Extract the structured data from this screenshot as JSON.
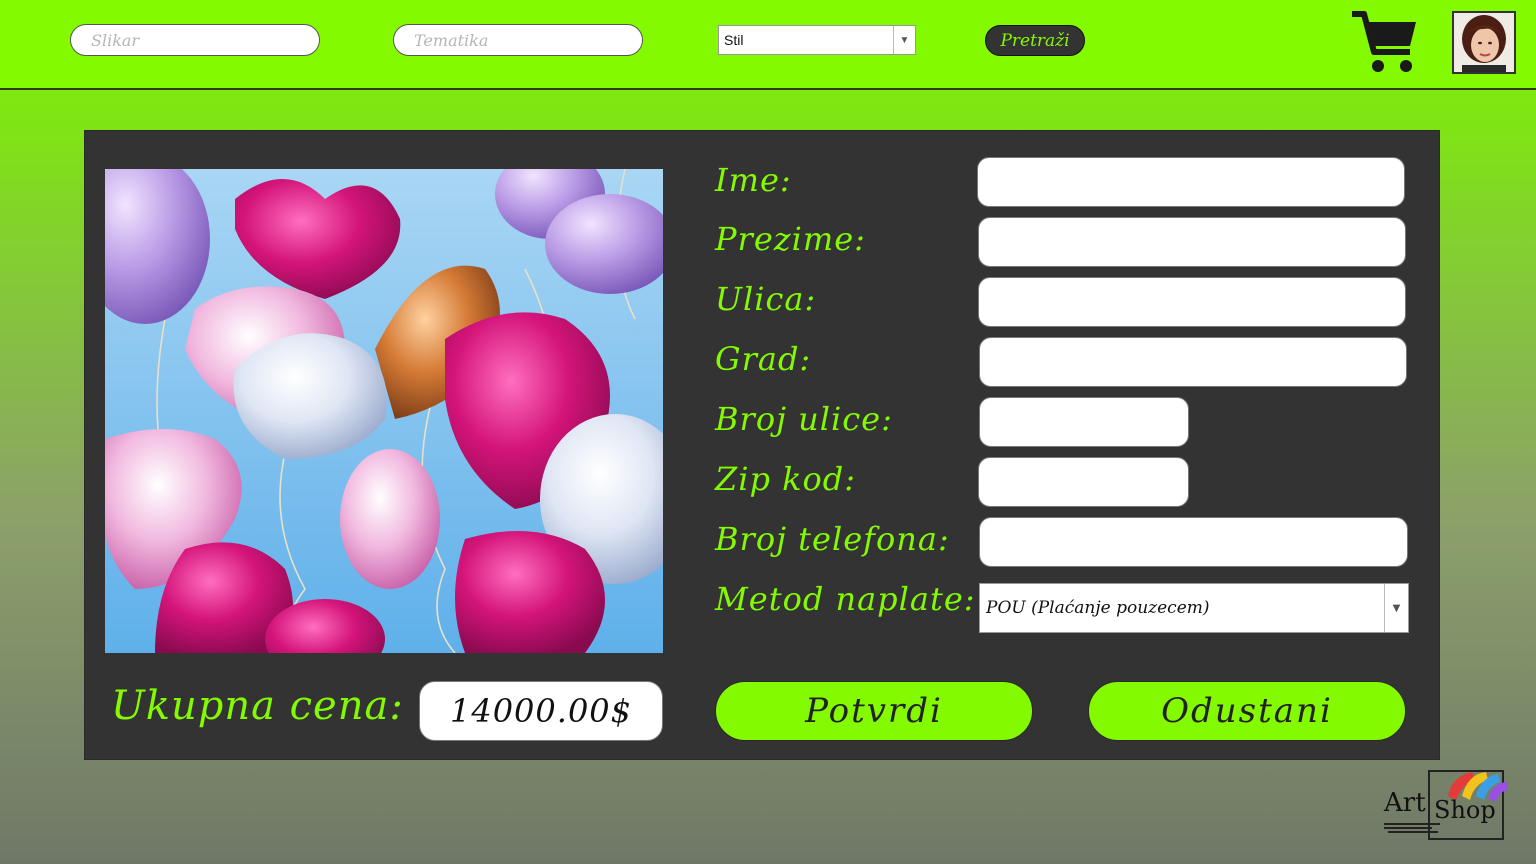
{
  "header": {
    "painter_placeholder": "Slikar",
    "theme_placeholder": "Tematika",
    "style_selected": "Stil",
    "search_label": "Pretraži"
  },
  "form": {
    "first_name_label": "Ime:",
    "last_name_label": "Prezime:",
    "street_label": "Ulica:",
    "city_label": "Grad:",
    "street_number_label": "Broj ulice:",
    "zip_label": "Zip kod:",
    "phone_label": "Broj telefona:",
    "payment_label": "Metod naplate:",
    "payment_selected": "POU (Plaćanje pouzecem)",
    "first_name_value": "",
    "last_name_value": "",
    "street_value": "",
    "city_value": "",
    "street_number_value": "",
    "zip_value": "",
    "phone_value": ""
  },
  "summary": {
    "total_label": "Ukupna cena:",
    "total_value": "14000.00$"
  },
  "actions": {
    "confirm_label": "Potvrdi",
    "cancel_label": "Odustani"
  },
  "logo": {
    "art": "Art",
    "shop": "Shop"
  },
  "colors": {
    "accent": "#84fa00",
    "panel": "#333333"
  },
  "icons": [
    "cart-icon",
    "user-avatar",
    "dropdown-arrow-icon"
  ]
}
